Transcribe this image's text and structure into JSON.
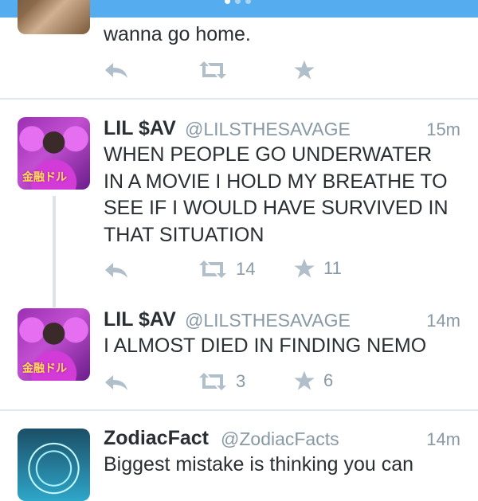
{
  "tweet_top": {
    "text_tail": "wanna go home."
  },
  "tweet_sav1": {
    "name": "LIL $AV",
    "handle": "@LILSTHESAVAGE",
    "time": "15m",
    "text_lines": [
      "WHEN PEOPLE GO UNDERWATER",
      "IN A MOVIE I HOLD MY BREATHE TO",
      "SEE IF I WOULD HAVE SURVIVED IN",
      "THAT SITUATION"
    ],
    "retweets": "14",
    "favorites": "11",
    "avatar_text": "金融ドル"
  },
  "tweet_sav2": {
    "name": "LIL $AV",
    "handle": "@LILSTHESAVAGE",
    "time": "14m",
    "text": "I ALMOST DIED IN FINDING NEMO",
    "retweets": "3",
    "favorites": "6",
    "avatar_text": "金融ドル"
  },
  "tweet_zodiac": {
    "name": "ZodiacFact",
    "handle": "@ZodiacFacts",
    "time": "14m",
    "text": "Biggest mistake is thinking you can"
  },
  "colors": {
    "topbar": "#55acee",
    "icon": "#b0bfca",
    "muted_text": "#8899a6",
    "divider": "#e1e8ed"
  }
}
